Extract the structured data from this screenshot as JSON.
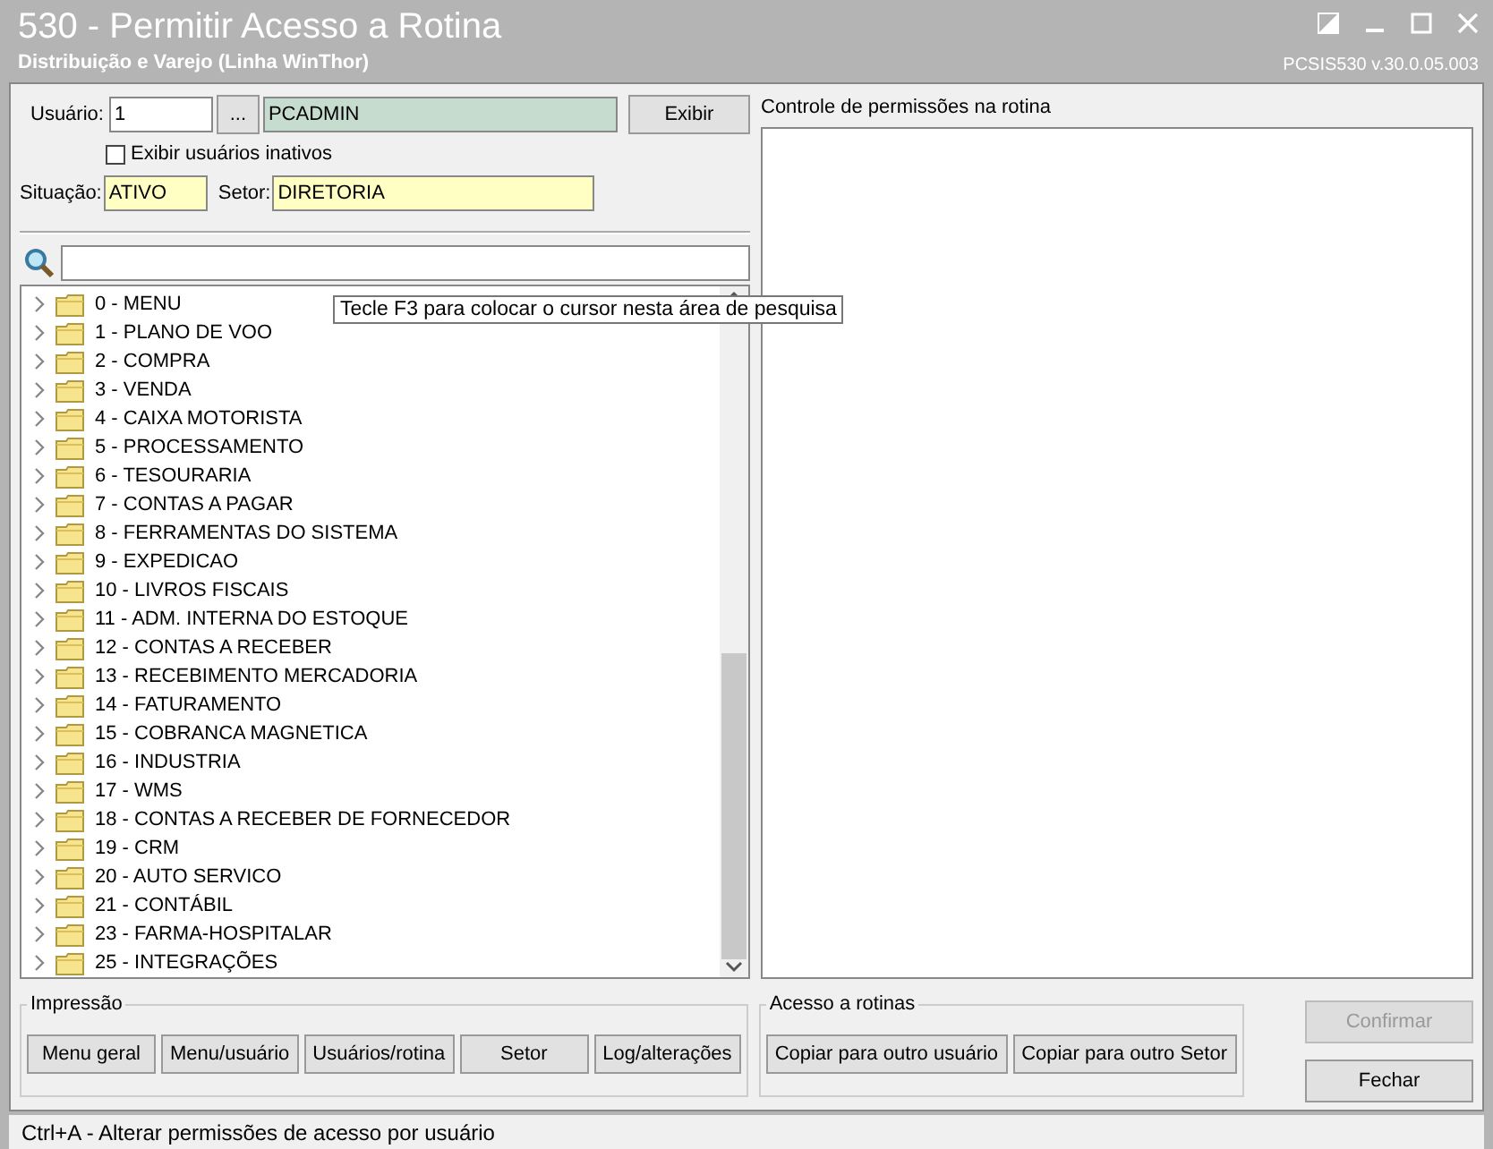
{
  "window": {
    "title": "530 - Permitir Acesso a Rotina",
    "subtitle": "Distribuição e Varejo (Linha WinThor)",
    "version": "PCSIS530  v.30.0.05.003"
  },
  "user": {
    "label": "Usuário:",
    "code": "1",
    "browse": "...",
    "name": "PCADMIN",
    "show_button": "Exibir"
  },
  "show_inactive": {
    "label": "Exibir usuários inativos",
    "checked": false
  },
  "status": {
    "label": "Situação:",
    "value": "ATIVO"
  },
  "sector": {
    "label": "Setor:",
    "value": "DIRETORIA"
  },
  "search": {
    "tooltip": "Tecle F3 para colocar o cursor nesta área de pesquisa"
  },
  "tree": [
    {
      "label": "0 - MENU",
      "expanded": false
    },
    {
      "label": "1 - PLANO DE VOO",
      "expanded": false
    },
    {
      "label": "2 - COMPRA",
      "expanded": false
    },
    {
      "label": "3 - VENDA",
      "expanded": false
    },
    {
      "label": "4 - CAIXA MOTORISTA",
      "expanded": false
    },
    {
      "label": "5 - PROCESSAMENTO",
      "expanded": false
    },
    {
      "label": "6 - TESOURARIA",
      "expanded": false
    },
    {
      "label": "7 - CONTAS A PAGAR",
      "expanded": false
    },
    {
      "label": "8 - FERRAMENTAS DO SISTEMA",
      "expanded": false
    },
    {
      "label": "9 - EXPEDICAO",
      "expanded": false
    },
    {
      "label": "10 - LIVROS FISCAIS",
      "expanded": false
    },
    {
      "label": "11 - ADM. INTERNA DO ESTOQUE",
      "expanded": false
    },
    {
      "label": "12 - CONTAS A RECEBER",
      "expanded": false
    },
    {
      "label": "13 - RECEBIMENTO MERCADORIA",
      "expanded": false
    },
    {
      "label": "14 - FATURAMENTO",
      "expanded": false
    },
    {
      "label": "15 - COBRANCA MAGNETICA",
      "expanded": false
    },
    {
      "label": "16 - INDUSTRIA",
      "expanded": false
    },
    {
      "label": "17 - WMS",
      "expanded": false
    },
    {
      "label": "18 - CONTAS A RECEBER DE FORNECEDOR",
      "expanded": false
    },
    {
      "label": "19 - CRM",
      "expanded": false
    },
    {
      "label": "20 - AUTO SERVICO",
      "expanded": false
    },
    {
      "label": "21 - CONTÁBIL",
      "expanded": false
    },
    {
      "label": "23 - FARMA-HOSPITALAR",
      "expanded": false
    },
    {
      "label": "25 - INTEGRAÇÕES",
      "expanded": false
    }
  ],
  "permissions": {
    "title": "Controle de permissões na rotina"
  },
  "printing": {
    "title": "Impressão",
    "buttons": [
      "Menu geral",
      "Menu/usuário",
      "Usuários/rotina",
      "Setor",
      "Log/alterações"
    ]
  },
  "access": {
    "title": "Acesso a rotinas",
    "buttons": [
      "Copiar para outro usuário",
      "Copiar para outro Setor"
    ]
  },
  "actions": [
    {
      "label": "Confirmar",
      "disabled": true
    },
    {
      "label": "Fechar",
      "disabled": false
    }
  ],
  "status_bar": "Ctrl+A - Alterar permissões de acesso por usuário"
}
